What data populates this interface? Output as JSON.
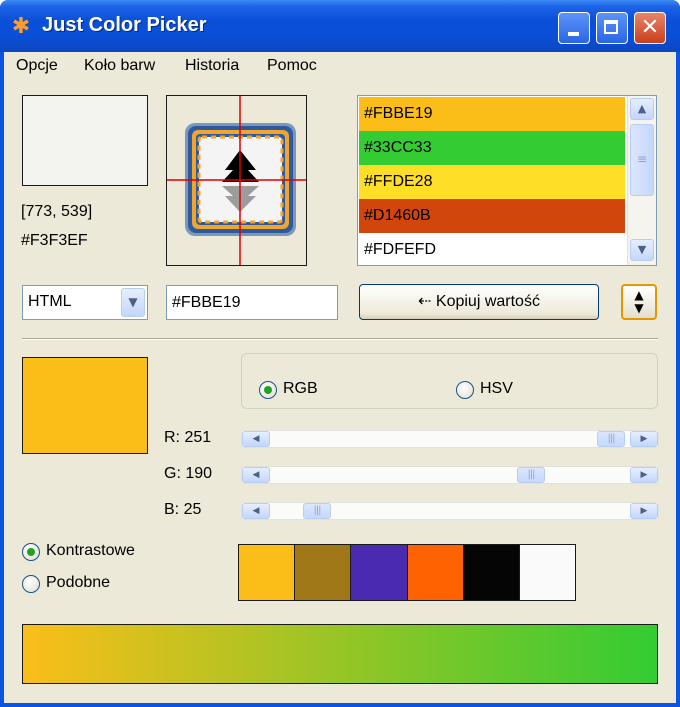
{
  "window": {
    "title": "Just Color Picker",
    "icon": "asterisk-icon"
  },
  "titlebar_buttons": {
    "minimize_icon": "minimize-icon",
    "maximize_icon": "maximize-icon",
    "close_glyph": "✕"
  },
  "menu": [
    {
      "label": "Opcje"
    },
    {
      "label": "Koło barw"
    },
    {
      "label": "Historia"
    },
    {
      "label": "Pomoc"
    }
  ],
  "picker": {
    "preview_color": "#F3F3EF",
    "coords": "[773, 539]",
    "hex": "#F3F3EF"
  },
  "history": [
    {
      "value": "#FBBE19",
      "color": "#FBBE19"
    },
    {
      "value": "#33CC33",
      "color": "#33CC33"
    },
    {
      "value": "#FFDE28",
      "color": "#FFDE28"
    },
    {
      "value": "#D1460B",
      "color": "#D1460B"
    },
    {
      "value": "#FDFEFD",
      "color": "#FFFFFF"
    }
  ],
  "format": {
    "selected": "HTML"
  },
  "current_value": "#FBBE19",
  "copy_button": {
    "label": "⇠ Kopiuj wartość"
  },
  "selected_color": "#FBBE19",
  "mode": {
    "rgb_label": "RGB",
    "hsv_label": "HSV",
    "selected": "RGB"
  },
  "channels": [
    {
      "label": "R: 251",
      "value": 251,
      "max": 255
    },
    {
      "label": "G: 190",
      "value": 190,
      "max": 255
    },
    {
      "label": "B: 25",
      "value": 25,
      "max": 255
    }
  ],
  "scheme": {
    "contrast_label": "Kontrastowe",
    "similar_label": "Podobne",
    "selected": "Kontrastowe"
  },
  "palette": [
    "#FBBE19",
    "#A07818",
    "#4A2AB0",
    "#FF6200",
    "#050505",
    "#FAFAFA"
  ],
  "gradient": {
    "from": "#FBBE19",
    "to": "#33CC33"
  }
}
